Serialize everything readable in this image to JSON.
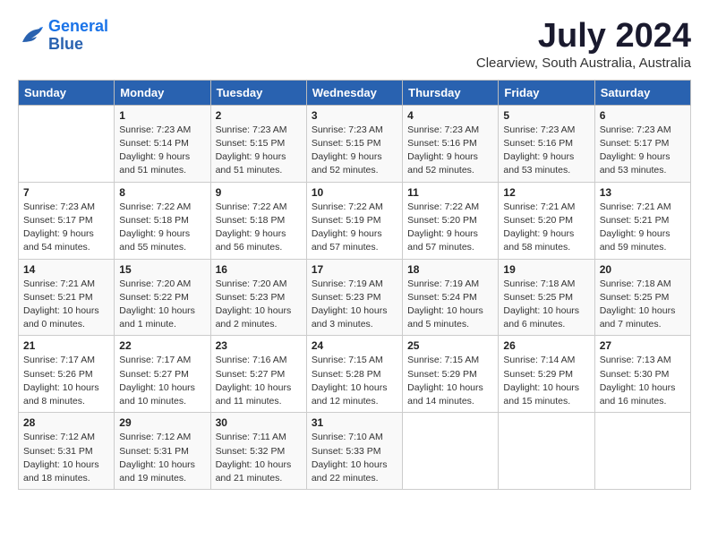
{
  "logo": {
    "line1": "General",
    "line2": "Blue"
  },
  "title": "July 2024",
  "subtitle": "Clearview, South Australia, Australia",
  "header_days": [
    "Sunday",
    "Monday",
    "Tuesday",
    "Wednesday",
    "Thursday",
    "Friday",
    "Saturday"
  ],
  "weeks": [
    [
      {
        "day": "",
        "info": ""
      },
      {
        "day": "1",
        "info": "Sunrise: 7:23 AM\nSunset: 5:14 PM\nDaylight: 9 hours\nand 51 minutes."
      },
      {
        "day": "2",
        "info": "Sunrise: 7:23 AM\nSunset: 5:15 PM\nDaylight: 9 hours\nand 51 minutes."
      },
      {
        "day": "3",
        "info": "Sunrise: 7:23 AM\nSunset: 5:15 PM\nDaylight: 9 hours\nand 52 minutes."
      },
      {
        "day": "4",
        "info": "Sunrise: 7:23 AM\nSunset: 5:16 PM\nDaylight: 9 hours\nand 52 minutes."
      },
      {
        "day": "5",
        "info": "Sunrise: 7:23 AM\nSunset: 5:16 PM\nDaylight: 9 hours\nand 53 minutes."
      },
      {
        "day": "6",
        "info": "Sunrise: 7:23 AM\nSunset: 5:17 PM\nDaylight: 9 hours\nand 53 minutes."
      }
    ],
    [
      {
        "day": "7",
        "info": "Sunrise: 7:23 AM\nSunset: 5:17 PM\nDaylight: 9 hours\nand 54 minutes."
      },
      {
        "day": "8",
        "info": "Sunrise: 7:22 AM\nSunset: 5:18 PM\nDaylight: 9 hours\nand 55 minutes."
      },
      {
        "day": "9",
        "info": "Sunrise: 7:22 AM\nSunset: 5:18 PM\nDaylight: 9 hours\nand 56 minutes."
      },
      {
        "day": "10",
        "info": "Sunrise: 7:22 AM\nSunset: 5:19 PM\nDaylight: 9 hours\nand 57 minutes."
      },
      {
        "day": "11",
        "info": "Sunrise: 7:22 AM\nSunset: 5:20 PM\nDaylight: 9 hours\nand 57 minutes."
      },
      {
        "day": "12",
        "info": "Sunrise: 7:21 AM\nSunset: 5:20 PM\nDaylight: 9 hours\nand 58 minutes."
      },
      {
        "day": "13",
        "info": "Sunrise: 7:21 AM\nSunset: 5:21 PM\nDaylight: 9 hours\nand 59 minutes."
      }
    ],
    [
      {
        "day": "14",
        "info": "Sunrise: 7:21 AM\nSunset: 5:21 PM\nDaylight: 10 hours\nand 0 minutes."
      },
      {
        "day": "15",
        "info": "Sunrise: 7:20 AM\nSunset: 5:22 PM\nDaylight: 10 hours\nand 1 minute."
      },
      {
        "day": "16",
        "info": "Sunrise: 7:20 AM\nSunset: 5:23 PM\nDaylight: 10 hours\nand 2 minutes."
      },
      {
        "day": "17",
        "info": "Sunrise: 7:19 AM\nSunset: 5:23 PM\nDaylight: 10 hours\nand 3 minutes."
      },
      {
        "day": "18",
        "info": "Sunrise: 7:19 AM\nSunset: 5:24 PM\nDaylight: 10 hours\nand 5 minutes."
      },
      {
        "day": "19",
        "info": "Sunrise: 7:18 AM\nSunset: 5:25 PM\nDaylight: 10 hours\nand 6 minutes."
      },
      {
        "day": "20",
        "info": "Sunrise: 7:18 AM\nSunset: 5:25 PM\nDaylight: 10 hours\nand 7 minutes."
      }
    ],
    [
      {
        "day": "21",
        "info": "Sunrise: 7:17 AM\nSunset: 5:26 PM\nDaylight: 10 hours\nand 8 minutes."
      },
      {
        "day": "22",
        "info": "Sunrise: 7:17 AM\nSunset: 5:27 PM\nDaylight: 10 hours\nand 10 minutes."
      },
      {
        "day": "23",
        "info": "Sunrise: 7:16 AM\nSunset: 5:27 PM\nDaylight: 10 hours\nand 11 minutes."
      },
      {
        "day": "24",
        "info": "Sunrise: 7:15 AM\nSunset: 5:28 PM\nDaylight: 10 hours\nand 12 minutes."
      },
      {
        "day": "25",
        "info": "Sunrise: 7:15 AM\nSunset: 5:29 PM\nDaylight: 10 hours\nand 14 minutes."
      },
      {
        "day": "26",
        "info": "Sunrise: 7:14 AM\nSunset: 5:29 PM\nDaylight: 10 hours\nand 15 minutes."
      },
      {
        "day": "27",
        "info": "Sunrise: 7:13 AM\nSunset: 5:30 PM\nDaylight: 10 hours\nand 16 minutes."
      }
    ],
    [
      {
        "day": "28",
        "info": "Sunrise: 7:12 AM\nSunset: 5:31 PM\nDaylight: 10 hours\nand 18 minutes."
      },
      {
        "day": "29",
        "info": "Sunrise: 7:12 AM\nSunset: 5:31 PM\nDaylight: 10 hours\nand 19 minutes."
      },
      {
        "day": "30",
        "info": "Sunrise: 7:11 AM\nSunset: 5:32 PM\nDaylight: 10 hours\nand 21 minutes."
      },
      {
        "day": "31",
        "info": "Sunrise: 7:10 AM\nSunset: 5:33 PM\nDaylight: 10 hours\nand 22 minutes."
      },
      {
        "day": "",
        "info": ""
      },
      {
        "day": "",
        "info": ""
      },
      {
        "day": "",
        "info": ""
      }
    ]
  ]
}
